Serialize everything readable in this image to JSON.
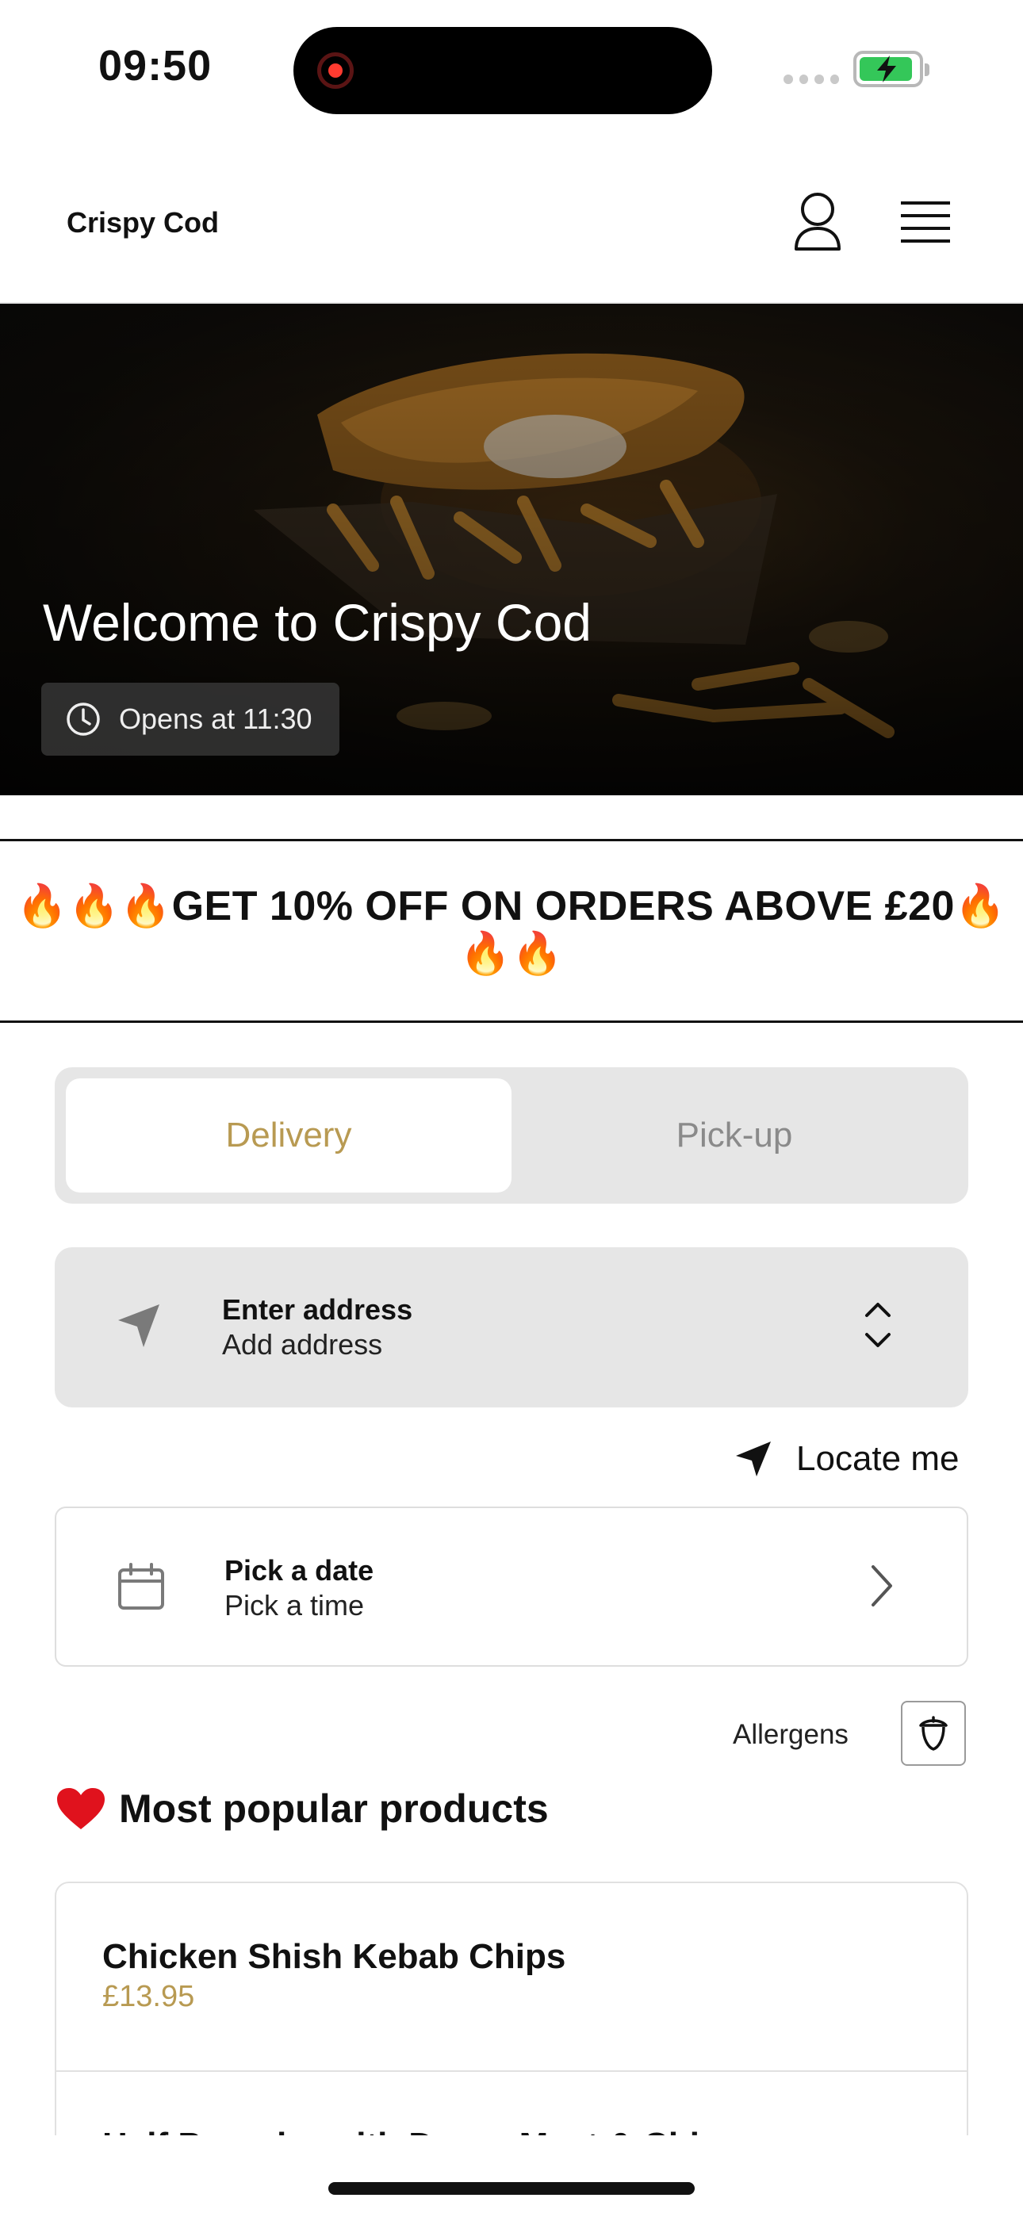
{
  "status_bar": {
    "time": "09:50"
  },
  "header": {
    "brand": "Crispy Cod",
    "icons": [
      "user-icon",
      "menu-icon"
    ]
  },
  "hero": {
    "title": "Welcome to Crispy Cod",
    "hours": "Opens at 11:30"
  },
  "promo": {
    "text": "🔥🔥🔥GET 10% OFF ON ORDERS ABOVE £20🔥🔥🔥"
  },
  "order_mode": {
    "delivery_label": "Delivery",
    "pickup_label": "Pick-up",
    "selected": "Delivery"
  },
  "address": {
    "title": "Enter address",
    "subtitle": "Add address"
  },
  "locate": {
    "label": "Locate me"
  },
  "schedule": {
    "date_label": "Pick a date",
    "time_label": "Pick a time"
  },
  "allergens": {
    "label": "Allergens"
  },
  "popular": {
    "title": "Most popular products",
    "products": [
      {
        "name": "Chicken Shish Kebab Chips",
        "price": "£13.95"
      },
      {
        "name": "Half Pounder with Doner Meat & Chips",
        "price": ""
      }
    ]
  },
  "colors": {
    "accent": "#b89a52",
    "toggle_bg": "#e6e6e6",
    "battery": "#34c759",
    "record": "#ff3b30"
  }
}
